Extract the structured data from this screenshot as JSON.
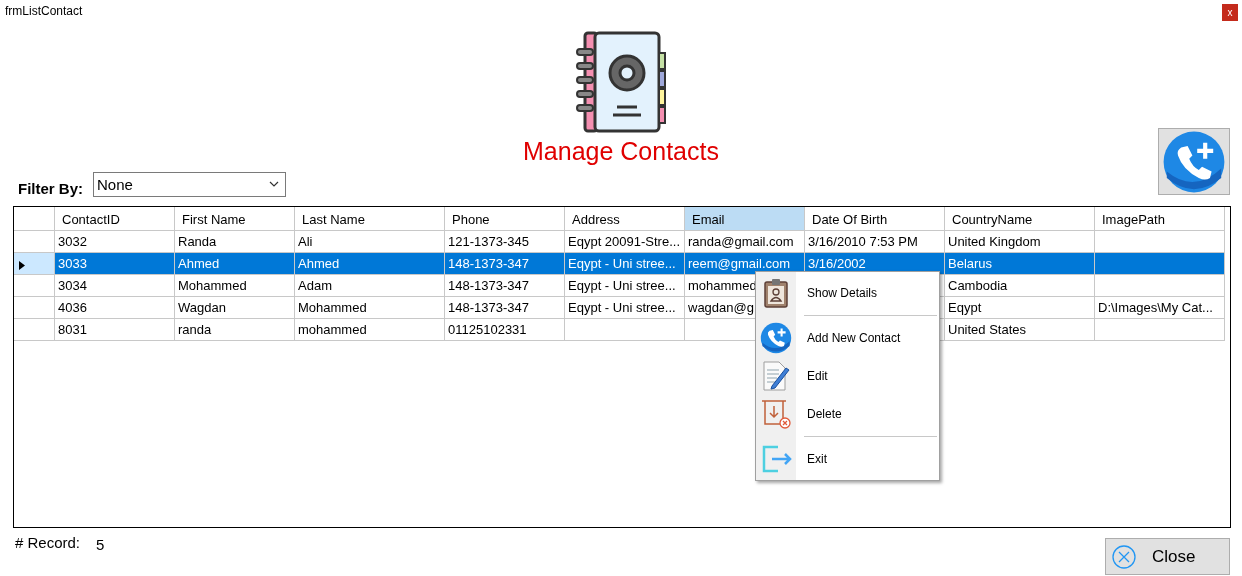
{
  "window": {
    "title": "frmListContact",
    "close": "x"
  },
  "header": {
    "title": "Manage Contacts"
  },
  "filter": {
    "label": "Filter By:",
    "value": "None"
  },
  "table": {
    "columns": [
      {
        "label": "ContactID",
        "highlighted": false
      },
      {
        "label": "First Name",
        "highlighted": false
      },
      {
        "label": "Last Name",
        "highlighted": false
      },
      {
        "label": "Phone",
        "highlighted": false
      },
      {
        "label": "Address",
        "highlighted": false
      },
      {
        "label": "Email",
        "highlighted": true
      },
      {
        "label": "Date Of Birth",
        "highlighted": false
      },
      {
        "label": "CountryName",
        "highlighted": false
      },
      {
        "label": "ImagePath",
        "highlighted": false
      }
    ],
    "rows": [
      {
        "selected": false,
        "cells": [
          "3032",
          "Randa",
          "Ali",
          "121-1373-345",
          "Eqypt 20091-Stre...",
          "randa@gmail.com",
          "3/16/2010 7:53 PM",
          "United Kingdom",
          ""
        ]
      },
      {
        "selected": true,
        "cells": [
          "3033",
          "Ahmed",
          "Ahmed",
          "148-1373-347",
          "Eqypt  - Uni stree...",
          "reem@gmail.com",
          "3/16/2002",
          "Belarus",
          ""
        ]
      },
      {
        "selected": false,
        "cells": [
          "3034",
          "Mohammed",
          "Adam",
          "148-1373-347",
          "Eqypt  - Uni stree...",
          "mohammed",
          "",
          "Cambodia",
          ""
        ]
      },
      {
        "selected": false,
        "cells": [
          "4036",
          "Wagdan",
          "Mohammed",
          "148-1373-347",
          "Eqypt  - Uni stree...",
          "wagdan@g",
          "",
          "Eqypt",
          "D:\\Images\\My Cat..."
        ]
      },
      {
        "selected": false,
        "cells": [
          "8031",
          "randa",
          "mohammed",
          "01125102331",
          "",
          "",
          "",
          "United States",
          ""
        ]
      }
    ]
  },
  "context_menu": {
    "items": [
      {
        "kind": "item",
        "label": "Show Details"
      },
      {
        "kind": "separator"
      },
      {
        "kind": "item",
        "label": "Add New Contact"
      },
      {
        "kind": "item",
        "label": "Edit"
      },
      {
        "kind": "item",
        "label": "Delete"
      },
      {
        "kind": "separator"
      },
      {
        "kind": "item",
        "label": "Exit"
      }
    ]
  },
  "footer": {
    "record_label": "# Record:",
    "record_count": "5",
    "close_button": "Close"
  }
}
